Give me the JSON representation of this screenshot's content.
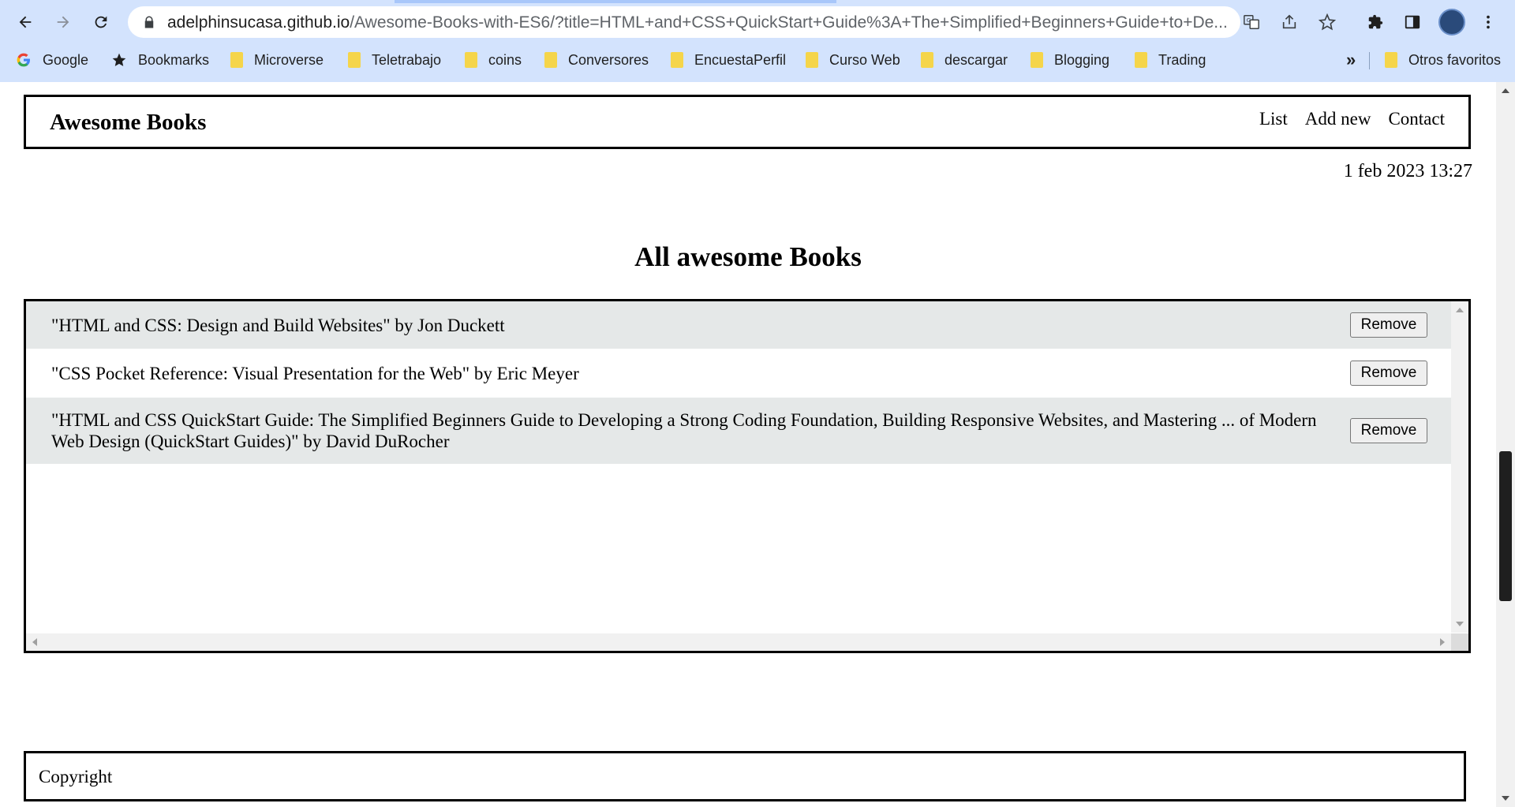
{
  "browser": {
    "url_host": "adelphinsucasa.github.io",
    "url_path": "/Awesome-Books-with-ES6/?title=HTML+and+CSS+QuickStart+Guide%3A+The+Simplified+Beginners+Guide+to+De...",
    "bookmarks": [
      {
        "label": "Google",
        "icon": "google-icon"
      },
      {
        "label": "Bookmarks",
        "icon": "star-icon"
      },
      {
        "label": "Microverse",
        "icon": "folder-icon"
      },
      {
        "label": "Teletrabajo",
        "icon": "folder-icon"
      },
      {
        "label": "coins",
        "icon": "folder-icon"
      },
      {
        "label": "Conversores",
        "icon": "folder-icon"
      },
      {
        "label": "EncuestaPerfil",
        "icon": "folder-icon"
      },
      {
        "label": "Curso Web",
        "icon": "folder-icon"
      },
      {
        "label": "descargar",
        "icon": "folder-icon"
      },
      {
        "label": "Blogging",
        "icon": "folder-icon"
      },
      {
        "label": "Trading",
        "icon": "folder-icon"
      }
    ],
    "overflow_label": "»",
    "other_bookmarks": "Otros favoritos"
  },
  "header": {
    "brand": "Awesome Books",
    "nav": [
      "List",
      "Add new",
      "Contact"
    ]
  },
  "datetime": "1 feb 2023 13:27",
  "section_title": "All awesome Books",
  "books": [
    {
      "text": "\"HTML and CSS: Design and Build Websites\" by Jon Duckett",
      "button": "Remove"
    },
    {
      "text": "\"CSS Pocket Reference: Visual Presentation for the Web\" by Eric Meyer",
      "button": "Remove"
    },
    {
      "text": "\"HTML and CSS QuickStart Guide: The Simplified Beginners Guide to Developing a Strong Coding Foundation, Building Responsive Websites, and Mastering ... of Modern Web Design (QuickStart Guides)\" by David DuRocher",
      "button": "Remove"
    }
  ],
  "footer": {
    "text": "Copyright"
  },
  "colors": {
    "chrome_bg": "#d3e3fd",
    "row_alt": "#e5e8e8",
    "border": "#000000"
  }
}
